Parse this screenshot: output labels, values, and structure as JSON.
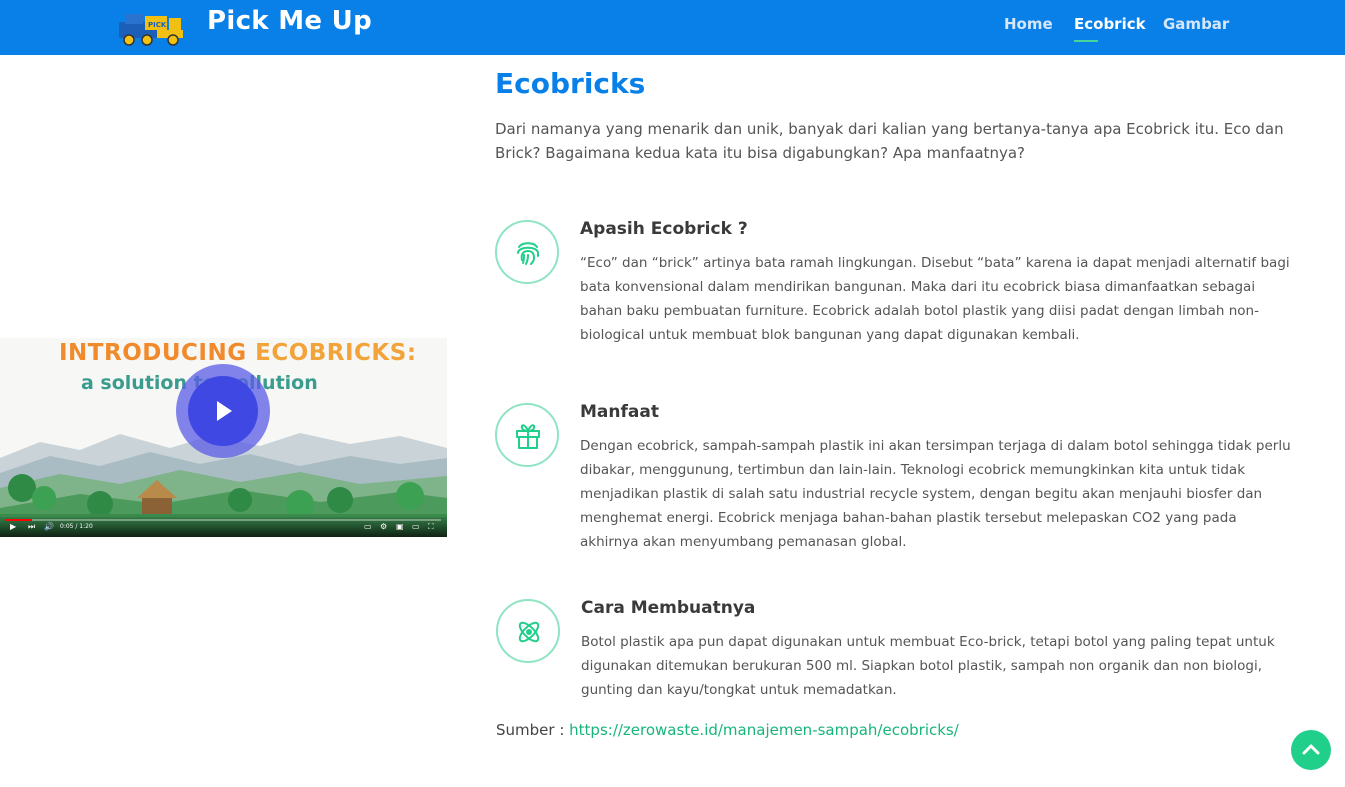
{
  "header": {
    "brand": "Pick Me Up",
    "logo_badge": "PICK",
    "nav": [
      {
        "label": "Home",
        "active": false
      },
      {
        "label": "Ecobrick",
        "active": true
      },
      {
        "label": "Gambar",
        "active": false
      }
    ],
    "colors": {
      "bar": "#0880e8",
      "active_underline": "#47d49c"
    }
  },
  "video": {
    "title_line1_a": "INTRODUCING ",
    "title_line1_b": "ECOBRICKS:",
    "title_line2": "a solution to pollution",
    "time": "0:05 / 1:20",
    "progress": 0.06,
    "play_icon": "play-icon"
  },
  "main": {
    "title": "Ecobricks",
    "intro": "Dari namanya yang menarik dan unik, banyak dari kalian yang bertanya-tanya apa Ecobrick itu. Eco dan Brick? Bagaimana kedua kata itu bisa digabungkan? Apa manfaatnya?",
    "sections": [
      {
        "icon": "fingerprint-icon",
        "title": "Apasih Ecobrick ?",
        "text": "“Eco” dan “brick” artinya bata ramah lingkungan. Disebut “bata” karena ia dapat menjadi alternatif bagi bata konvensional dalam mendirikan bangunan. Maka dari itu ecobrick biasa dimanfaatkan sebagai bahan baku pembuatan furniture. Ecobrick adalah botol plastik yang diisi padat dengan limbah non-biological untuk membuat blok bangunan yang dapat digunakan kembali."
      },
      {
        "icon": "gift-icon",
        "title": "Manfaat",
        "text": "Dengan ecobrick, sampah-sampah plastik ini akan tersimpan terjaga di dalam botol sehingga tidak perlu dibakar, menggunung, tertimbun dan lain-lain. Teknologi ecobrick memungkinkan kita untuk tidak menjadikan plastik di salah satu industrial recycle system, dengan begitu akan menjauhi biosfer dan menghemat energi. Ecobrick menjaga bahan-bahan plastik tersebut melepaskan CO2 yang pada akhirnya akan menyumbang pemanasan global."
      },
      {
        "icon": "atom-icon",
        "title": "Cara Membuatnya",
        "text": "Botol plastik apa pun dapat digunakan untuk membuat Eco-brick, tetapi botol yang paling tepat untuk digunakan ditemukan berukuran 500 ml. Siapkan botol plastik, sampah non organik dan non biologi, gunting dan kayu/tongkat untuk memadatkan."
      }
    ],
    "source_label": "Sumber : ",
    "source_link": "https://zerowaste.id/manajemen-sampah/ecobricks/",
    "accent": "#1fcf8a",
    "icon_border": "#8fe4c2"
  },
  "back_to_top_icon": "chevron-up-icon"
}
